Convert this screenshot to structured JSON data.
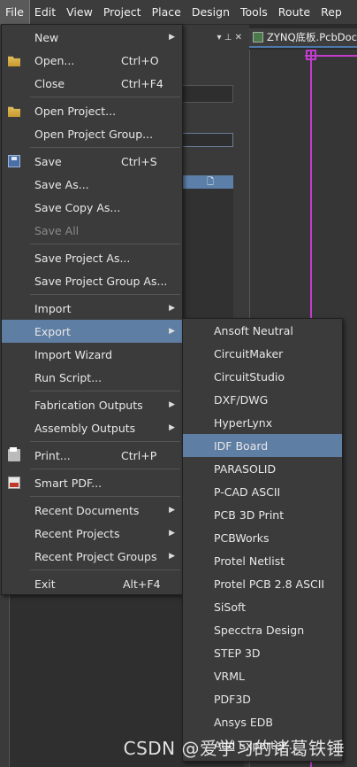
{
  "menubar": {
    "items": [
      "File",
      "Edit",
      "View",
      "Project",
      "Place",
      "Design",
      "Tools",
      "Route",
      "Rep"
    ]
  },
  "panel": {
    "header_controls": "▾ ⊥ ✕"
  },
  "doc_tab": {
    "label": "ZYNQ底板.PcbDoc"
  },
  "file_menu": {
    "items": [
      {
        "label": "New",
        "shortcut": "",
        "submenu": true
      },
      {
        "label": "Open...",
        "shortcut": "Ctrl+O",
        "icon": "folder-icon"
      },
      {
        "label": "Close",
        "shortcut": "Ctrl+F4"
      },
      {
        "label": "Open Project...",
        "shortcut": "",
        "icon": "folder-icon"
      },
      {
        "label": "Open Project Group...",
        "shortcut": ""
      },
      {
        "label": "Save",
        "shortcut": "Ctrl+S",
        "icon": "save-icon"
      },
      {
        "label": "Save As...",
        "shortcut": ""
      },
      {
        "label": "Save Copy As...",
        "shortcut": ""
      },
      {
        "label": "Save All",
        "shortcut": "",
        "disabled": true
      },
      {
        "label": "Save Project As...",
        "shortcut": ""
      },
      {
        "label": "Save Project Group As...",
        "shortcut": ""
      },
      {
        "label": "Import",
        "shortcut": "",
        "submenu": true
      },
      {
        "label": "Export",
        "shortcut": "",
        "submenu": true,
        "highlighted": true
      },
      {
        "label": "Import Wizard",
        "shortcut": ""
      },
      {
        "label": "Run Script...",
        "shortcut": ""
      },
      {
        "label": "Fabrication Outputs",
        "shortcut": "",
        "submenu": true
      },
      {
        "label": "Assembly Outputs",
        "shortcut": "",
        "submenu": true
      },
      {
        "label": "Print...",
        "shortcut": "Ctrl+P",
        "icon": "print-icon"
      },
      {
        "label": "Smart PDF...",
        "shortcut": "",
        "icon": "pdf-icon"
      },
      {
        "label": "Recent Documents",
        "shortcut": "",
        "submenu": true
      },
      {
        "label": "Recent Projects",
        "shortcut": "",
        "submenu": true
      },
      {
        "label": "Recent Project Groups",
        "shortcut": "",
        "submenu": true
      },
      {
        "label": "Exit",
        "shortcut": "Alt+F4"
      }
    ]
  },
  "export_menu": {
    "items": [
      "Ansoft Neutral",
      "CircuitMaker",
      "CircuitStudio",
      "DXF/DWG",
      "HyperLynx",
      "IDF Board",
      "PARASOLID",
      "P-CAD ASCII",
      "PCB 3D Print",
      "PCBWorks",
      "Protel Netlist",
      "Protel PCB 2.8 ASCII",
      "SiSoft",
      "Specctra Design",
      "STEP 3D",
      "VRML",
      "PDF3D",
      "Ansys EDB",
      "Add Exporter..."
    ],
    "highlighted": "IDF Board"
  },
  "watermark": "CSDN @爱学习的诸葛铁锤",
  "colors": {
    "highlight": "#5f7ea3",
    "menu_bg": "#3b3b3b",
    "accent_magenta": "#c23ccd"
  }
}
